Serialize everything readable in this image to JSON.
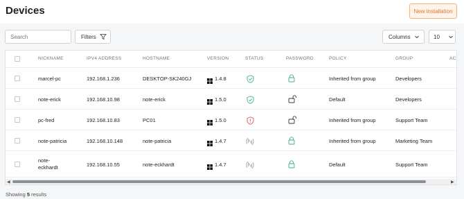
{
  "header": {
    "title": "Devices",
    "new_button": "New installation"
  },
  "toolbar": {
    "search_placeholder": "Search",
    "filters_label": "Filters",
    "columns_label": "Columns",
    "per_page": "10"
  },
  "table": {
    "columns": [
      "NICKNAME",
      "IPV4 ADDRESS",
      "HOSTNAME",
      "VERSION",
      "STATUS",
      "PASSWORD",
      "POLICY",
      "GROUP",
      "AC"
    ],
    "rows": [
      {
        "nickname": "marcel-pc",
        "ip": "192.168.1.236",
        "hostname": "DESKTOP-SK240GJ",
        "version": "1.4.8",
        "status": "shield-check",
        "password": "locked",
        "policy": "Inherited from group",
        "group": "Developers"
      },
      {
        "nickname": "note-erick",
        "ip": "192.168.10.98",
        "hostname": "note-erick",
        "version": "1.5.0",
        "status": "shield-check",
        "password": "unlocked",
        "policy": "Default",
        "group": "Developers"
      },
      {
        "nickname": "pc-fred",
        "ip": "192.168.10.83",
        "hostname": "PC01",
        "version": "1.5.0",
        "status": "shield-alert",
        "password": "unlocked",
        "policy": "Inherited from group",
        "group": "Support Team"
      },
      {
        "nickname": "note-patricia",
        "ip": "192.168.10.148",
        "hostname": "note-patricia",
        "version": "1.4.7",
        "status": "offline",
        "password": "locked",
        "policy": "Inherited from group",
        "group": "Marketing Team"
      },
      {
        "nickname_line1": "note-",
        "nickname_line2": "eckhardt",
        "ip": "192.168.10.55",
        "hostname": "note-eckhardt",
        "version": "1.4.7",
        "status": "offline",
        "password": "locked",
        "policy": "Default",
        "group": "Support Team"
      }
    ]
  },
  "footer": {
    "prefix": "Showing ",
    "count": "5",
    "suffix": " results"
  },
  "colors": {
    "accent": "#e07a2c",
    "ok": "#3bb07a",
    "alert": "#d9534f",
    "muted": "#9aa0a6"
  }
}
